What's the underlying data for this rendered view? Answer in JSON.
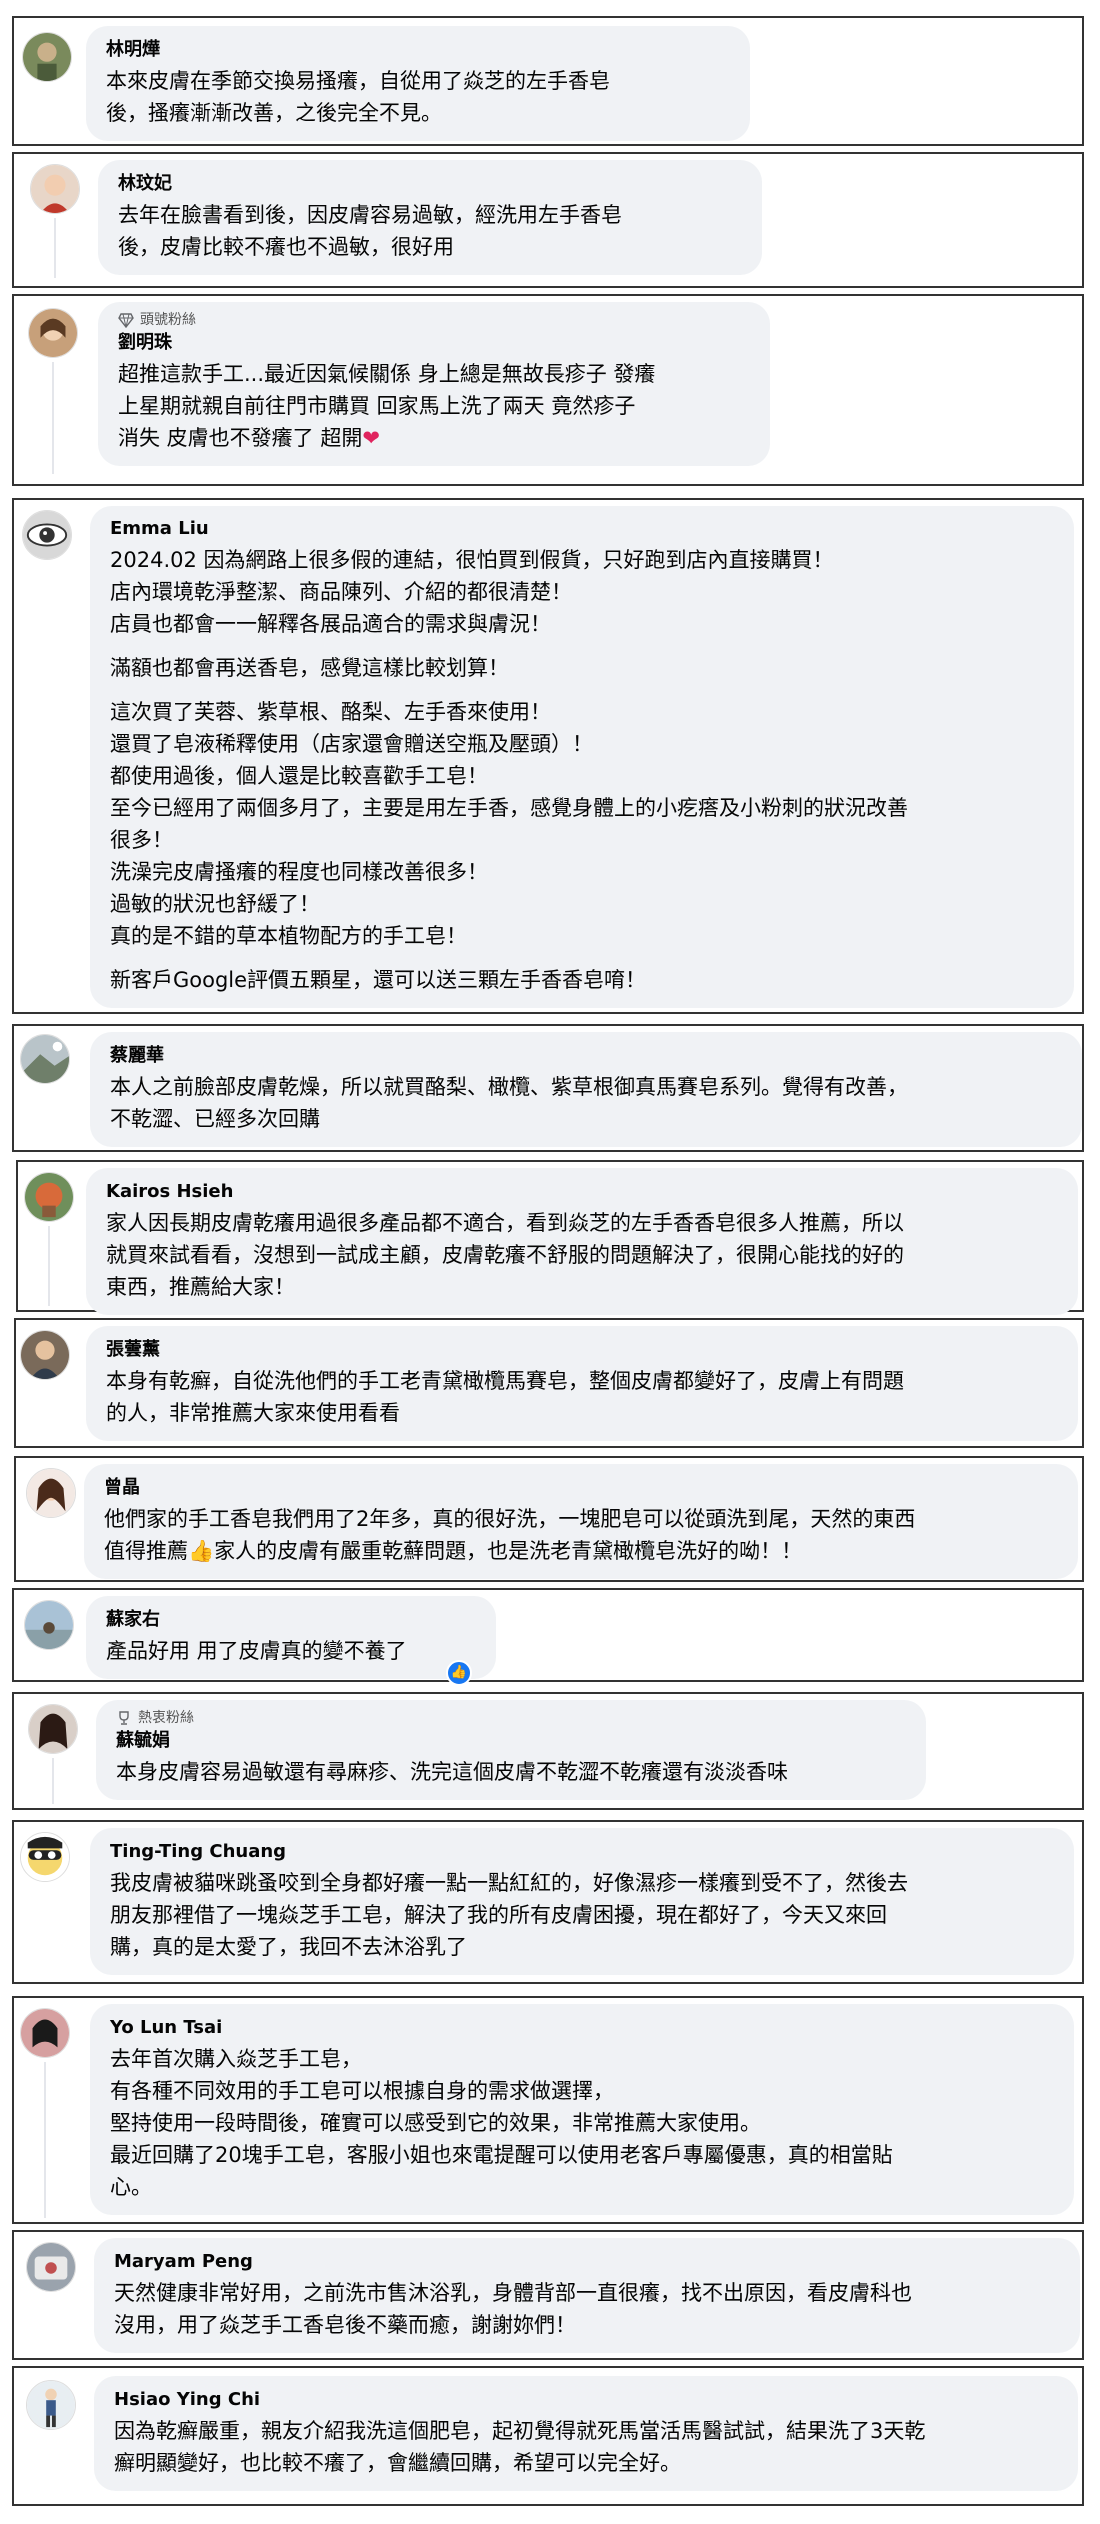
{
  "comments": [
    {
      "name": "林明燁",
      "lines": [
        "本來皮膚在季節交換易搔癢，自從用了焱芝的左手香皂",
        "後，搔癢漸漸改善，之後完全不見。"
      ]
    },
    {
      "name": "林玟妃",
      "lines": [
        "去年在臉書看到後，因皮膚容易過敏，經洗用左手香皂",
        "後，皮膚比較不癢也不過敏，很好用"
      ]
    },
    {
      "badge": "頭號粉絲",
      "name": "劉明珠",
      "lines": [
        "超推這款手工...最近因氣候關係 身上總是無故長疹子 發癢",
        "上星期就親自前往門市購買 回家馬上洗了兩天 竟然疹子",
        "消失 皮膚也不發癢了 超開"
      ],
      "heart": "❤"
    },
    {
      "name": "Emma Liu",
      "paragraphs": [
        [
          "2024.02 因為網路上很多假的連結，很怕買到假貨，只好跑到店內直接購買！",
          "店內環境乾淨整潔、商品陳列、介紹的都很清楚！",
          "店員也都會一一解釋各展品適合的需求與膚況！"
        ],
        [
          "滿額也都會再送香皂，感覺這樣比較划算！"
        ],
        [
          "這次買了芙蓉、紫草根、酪梨、左手香來使用！",
          "還買了皂液稀釋使用（店家還會贈送空瓶及壓頭）！",
          "都使用過後，個人還是比較喜歡手工皂！",
          "至今已經用了兩個多月了，主要是用左手香，感覺身體上的小疙瘩及小粉刺的狀況改善",
          "很多！",
          "洗澡完皮膚搔癢的程度也同樣改善很多！",
          "過敏的狀況也舒緩了！",
          "真的是不錯的草本植物配方的手工皂！"
        ],
        [
          "新客戶Google評價五顆星，還可以送三顆左手香香皂唷！"
        ]
      ]
    },
    {
      "name": "蔡麗華",
      "lines": [
        "本人之前臉部皮膚乾燥，所以就買酪梨、橄欖、紫草根御真馬賽皂系列。覺得有改善，",
        "不乾澀、已經多次回購"
      ]
    },
    {
      "name": "Kairos Hsieh",
      "lines": [
        "家人因長期皮膚乾癢用過很多產品都不適合，看到焱芝的左手香香皂很多人推薦，所以",
        "就買來試看看，沒想到一試成主顧，皮膚乾癢不舒服的問題解決了，很開心能找的好的",
        "東西，推薦給大家！"
      ]
    },
    {
      "name": "張蕓薰",
      "lines": [
        "本身有乾癬，自從洗他們的手工老青黛橄欖馬賽皂，整個皮膚都變好了，皮膚上有問題",
        "的人，非常推薦大家來使用看看"
      ]
    },
    {
      "name": "曾晶",
      "lines": [
        "他們家的手工香皂我們用了2年多，真的很好洗，一塊肥皂可以從頭洗到尾，天然的東西",
        "值得推薦👍家人的皮膚有嚴重乾蘚問題，也是洗老青黛橄欖皂洗好的呦！！"
      ]
    },
    {
      "name": "蘇家右",
      "lines": [
        "產品好用 用了皮膚真的變不養了"
      ],
      "reaction": "👍"
    },
    {
      "badge": "熱衷粉絲",
      "name": "蘇毓娟",
      "lines": [
        "本身皮膚容易過敏還有尋麻疹、洗完這個皮膚不乾澀不乾癢還有淡淡香味"
      ]
    },
    {
      "name": "Ting-Ting Chuang",
      "lines": [
        "我皮膚被貓咪跳蚤咬到全身都好癢一點一點紅紅的，好像濕疹一樣癢到受不了，然後去",
        "朋友那裡借了一塊焱芝手工皂，解決了我的所有皮膚困擾，現在都好了，今天又來回",
        "購，真的是太愛了，我回不去沐浴乳了"
      ]
    },
    {
      "name": "Yo Lun Tsai",
      "lines": [
        "去年首次購入焱芝手工皂，",
        "有各種不同效用的手工皂可以根據自身的需求做選擇，",
        "堅持使用一段時間後，確實可以感受到它的效果，非常推薦大家使用。",
        "最近回購了20塊手工皂，客服小姐也來電提醒可以使用老客戶專屬優惠，真的相當貼",
        "心。"
      ]
    },
    {
      "name": "Maryam Peng",
      "lines": [
        "天然健康非常好用，之前洗市售沐浴乳，身體背部一直很癢，找不出原因，看皮膚科也",
        "沒用，用了焱芝手工香皂後不藥而癒，謝謝妳們！"
      ]
    },
    {
      "name": "Hsiao Ying Chi",
      "lines": [
        "因為乾癬嚴重，親友介紹我洗這個肥皂，起初覺得就死馬當活馬醫試試，結果洗了3天乾",
        "癬明顯變好，也比較不癢了，會繼續回購，希望可以完全好。"
      ]
    }
  ]
}
